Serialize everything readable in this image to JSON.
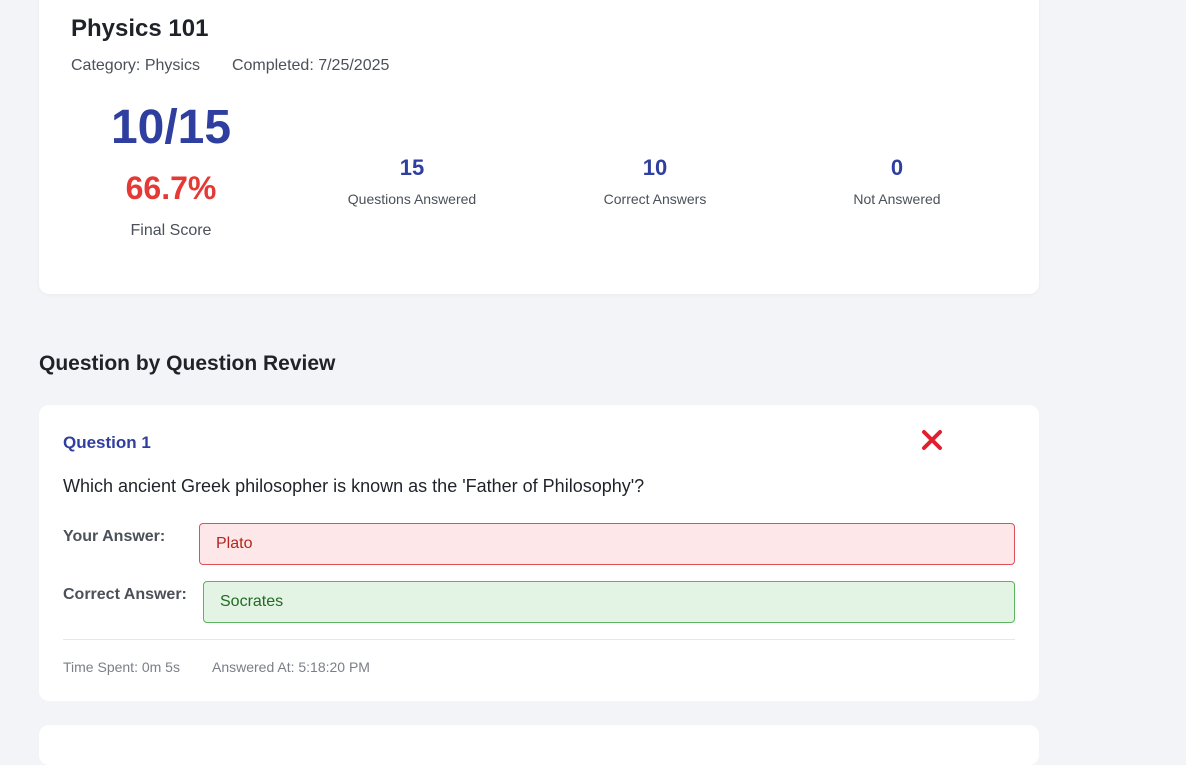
{
  "summary": {
    "title": "Physics 101",
    "category": "Category: Physics",
    "completed": "Completed: 7/25/2025",
    "score_fraction": "10/15",
    "score_percent": "66.7%",
    "score_label": "Final Score",
    "stats": [
      {
        "value": "15",
        "label": "Questions Answered"
      },
      {
        "value": "10",
        "label": "Correct Answers"
      },
      {
        "value": "0",
        "label": "Not Answered"
      }
    ]
  },
  "review": {
    "heading": "Question by Question Review",
    "questions": [
      {
        "number": "Question 1",
        "status_icon": "close-icon",
        "text": "Which ancient Greek philosopher is known as the 'Father of Philosophy'?",
        "your_answer_label": "Your Answer:",
        "your_answer": "Plato",
        "correct_answer_label": "Correct Answer:",
        "correct_answer": "Socrates",
        "time_spent": "Time Spent: 0m 5s",
        "answered_at": "Answered At: 5:18:20 PM"
      }
    ]
  },
  "colors": {
    "accent": "#2f3f9f",
    "error": "#e53935",
    "success": "#5cb360",
    "background": "#f3f4f8"
  }
}
